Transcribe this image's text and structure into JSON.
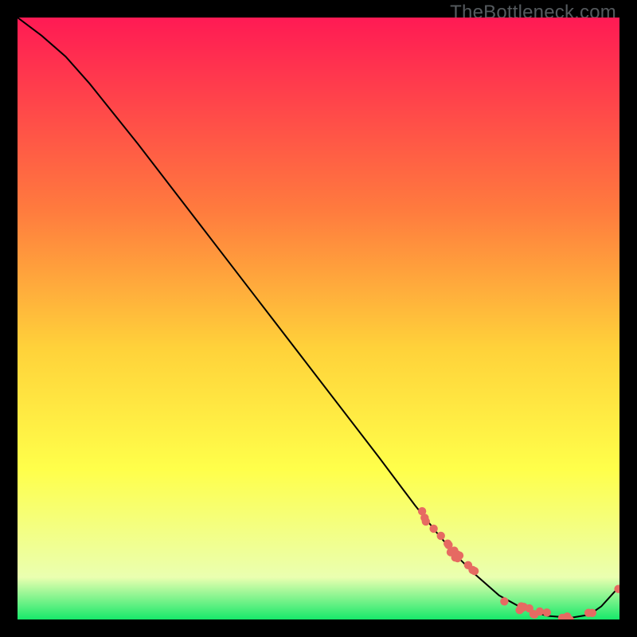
{
  "watermark": "TheBottleneck.com",
  "colors": {
    "grad_top": "#ff1a54",
    "grad_mid1": "#ff7b3e",
    "grad_mid2": "#ffd23a",
    "grad_mid3": "#ffff4a",
    "grad_low": "#eaffb0",
    "grad_bottom": "#17e86a",
    "line": "#000000",
    "dot": "#e66a62",
    "frame": "#000000"
  },
  "chart_data": {
    "type": "line",
    "title": "",
    "xlabel": "",
    "ylabel": "",
    "xlim": [
      0,
      100
    ],
    "ylim": [
      0,
      100
    ],
    "series": [
      {
        "name": "curve",
        "x": [
          0,
          4,
          8,
          12,
          20,
          30,
          40,
          50,
          60,
          66,
          70,
          73,
          76,
          80,
          84,
          88,
          92,
          95,
          97,
          100
        ],
        "y": [
          100,
          97,
          93.5,
          89,
          79,
          66,
          53,
          40,
          27,
          19,
          14,
          10.5,
          7.5,
          4,
          1.8,
          0.6,
          0.3,
          0.8,
          2.2,
          5.5
        ]
      }
    ],
    "dot_clusters": [
      {
        "x_range": [
          66,
          76
        ],
        "y_range": [
          8,
          19
        ],
        "count": 16
      },
      {
        "x_range": [
          80,
          92
        ],
        "y_range": [
          0.3,
          2.0
        ],
        "count": 14
      },
      {
        "x_range": [
          94,
          95.5
        ],
        "y_range": [
          0.6,
          1.2
        ],
        "count": 2
      },
      {
        "x_range": [
          99.5,
          100
        ],
        "y_range": [
          5.3,
          5.7
        ],
        "count": 1
      }
    ]
  }
}
